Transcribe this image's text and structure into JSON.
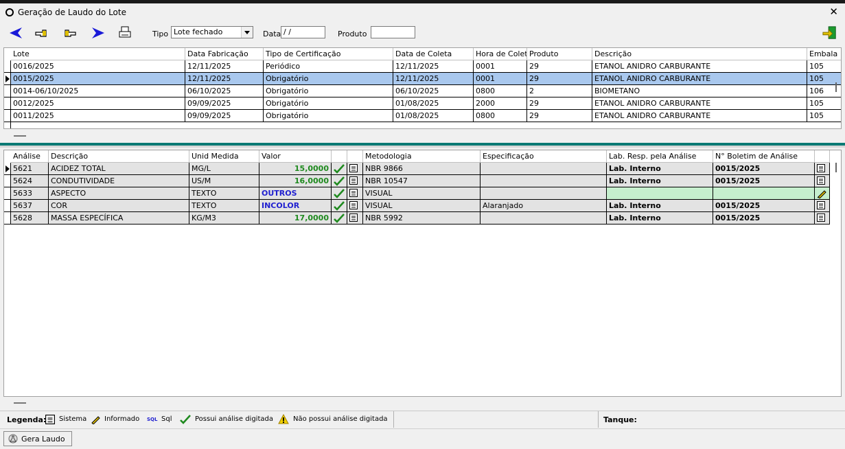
{
  "window": {
    "title": "Geração de Laudo do Lote",
    "close_glyph": "✕"
  },
  "toolbar": {
    "tipo_label": "Tipo",
    "tipo_value": "Lote fechado",
    "data_label": "Data",
    "data_value": " / /",
    "produto_label": "Produto",
    "produto_value": ""
  },
  "lotes": {
    "columns": [
      "Lote",
      "Data Fabricação",
      "Tipo de Certificação",
      "Data de Coleta",
      "Hora de Coleta",
      "Produto",
      "Descrição",
      "Embala"
    ],
    "rows": [
      {
        "lote": "0016/2025",
        "fab": "12/11/2025",
        "tipo": "Periódico",
        "coleta": "12/11/2025",
        "hora": "0001",
        "produto": "29",
        "desc": "ETANOL ANIDRO CARBURANTE",
        "emb": "105"
      },
      {
        "lote": "0015/2025",
        "fab": "12/11/2025",
        "tipo": "Obrigatório",
        "coleta": "12/11/2025",
        "hora": "0001",
        "produto": "29",
        "desc": "ETANOL ANIDRO CARBURANTE",
        "emb": "105"
      },
      {
        "lote": "0014-06/10/2025",
        "fab": "06/10/2025",
        "tipo": "Obrigatório",
        "coleta": "06/10/2025",
        "hora": "0800",
        "produto": "2",
        "desc": "BIOMETANO",
        "emb": "106"
      },
      {
        "lote": "0012/2025",
        "fab": "09/09/2025",
        "tipo": "Obrigatório",
        "coleta": "01/08/2025",
        "hora": "2000",
        "produto": "29",
        "desc": "ETANOL ANIDRO CARBURANTE",
        "emb": "105"
      },
      {
        "lote": "0011/2025",
        "fab": "09/09/2025",
        "tipo": "Obrigatório",
        "coleta": "01/08/2025",
        "hora": "0800",
        "produto": "29",
        "desc": "ETANOL ANIDRO CARBURANTE",
        "emb": "105"
      }
    ]
  },
  "analises": {
    "columns": [
      "Análise",
      "Descrição",
      "Unid Medida",
      "Valor",
      "",
      "",
      "Metodologia",
      "Especificação",
      "Lab. Resp. pela Análise",
      "N° Boletim de Análise"
    ],
    "rows": [
      {
        "cod": "5621",
        "desc": "ACIDEZ TOTAL",
        "unid": "MG/L",
        "valor": "15,0000",
        "metodo": "NBR 9866",
        "espec": "",
        "lab": "Lab. Interno",
        "boletim": "0015/2025"
      },
      {
        "cod": "5624",
        "desc": "CONDUTIVIDADE",
        "unid": "US/M",
        "valor": "16,0000",
        "metodo": "NBR 10547",
        "espec": "",
        "lab": "Lab. Interno",
        "boletim": "0015/2025"
      },
      {
        "cod": "5633",
        "desc": "ASPECTO",
        "unid": "TEXTO",
        "valor": "OUTROS",
        "metodo": "VISUAL",
        "espec": "",
        "lab": "",
        "boletim": ""
      },
      {
        "cod": "5637",
        "desc": "COR",
        "unid": "TEXTO",
        "valor": "INCOLOR",
        "metodo": "VISUAL",
        "espec": "Alaranjado",
        "lab": "Lab. Interno",
        "boletim": "0015/2025"
      },
      {
        "cod": "5628",
        "desc": "MASSA ESPECÍFICA",
        "unid": "KG/M3",
        "valor": "17,0000",
        "metodo": "NBR 5992",
        "espec": "",
        "lab": "Lab. Interno",
        "boletim": "0015/2025"
      }
    ]
  },
  "legend": {
    "title": "Legenda:",
    "sistema": "Sistema",
    "informado": "Informado",
    "sql_tag": "SQL",
    "sql": "Sql",
    "possui": "Possui análise digitada",
    "nao_possui": "Não possui análise digitada",
    "tanque": "Tanque:"
  },
  "bottom": {
    "gera_laudo": "Gera Laudo"
  },
  "icons": [
    "back-arrow-icon",
    "hand-left-icon",
    "hand-right-icon",
    "forward-arrow-icon",
    "printer-icon",
    "exit-door-icon",
    "check-icon",
    "system-doc-icon",
    "hand-write-icon",
    "warning-icon",
    "flask-icon"
  ]
}
